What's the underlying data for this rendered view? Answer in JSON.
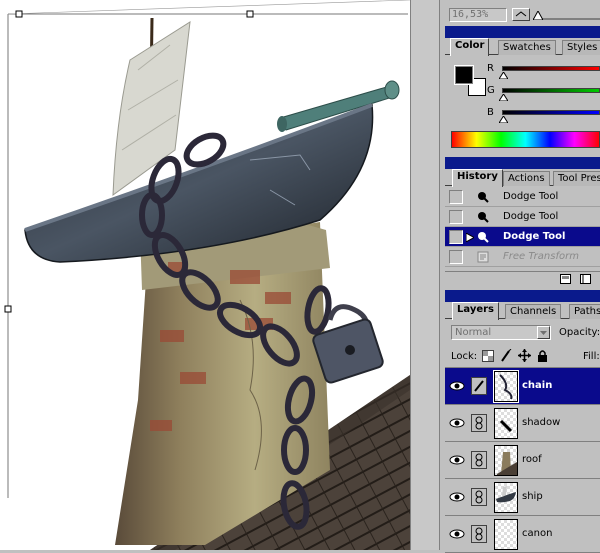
{
  "document": {
    "zoom": "16,53%"
  },
  "color_panel": {
    "tabs": [
      "Color",
      "Swatches",
      "Styles"
    ],
    "channels": [
      "R",
      "G",
      "B"
    ],
    "foreground": "#000000",
    "background": "#ffffff"
  },
  "history_panel": {
    "tabs": [
      "History",
      "Actions",
      "Tool Presets"
    ],
    "items": [
      {
        "label": "Dodge Tool",
        "state": "normal"
      },
      {
        "label": "Dodge Tool",
        "state": "normal"
      },
      {
        "label": "Dodge Tool",
        "state": "selected"
      },
      {
        "label": "Free Transform",
        "state": "undone"
      }
    ]
  },
  "layers_panel": {
    "tabs": [
      "Layers",
      "Channels",
      "Paths"
    ],
    "blend_mode": "Normal",
    "opacity_label": "Opacity:",
    "lock_label": "Lock:",
    "fill_label": "Fill:",
    "layers": [
      {
        "name": "chain",
        "selected": true
      },
      {
        "name": "shadow",
        "selected": false
      },
      {
        "name": "roof",
        "selected": false
      },
      {
        "name": "ship",
        "selected": false
      },
      {
        "name": "canon",
        "selected": false
      }
    ]
  },
  "colors": {
    "title_bar": "#0a1a8c",
    "selection": "#0a0a8c",
    "panel": "#c0c0c0"
  }
}
